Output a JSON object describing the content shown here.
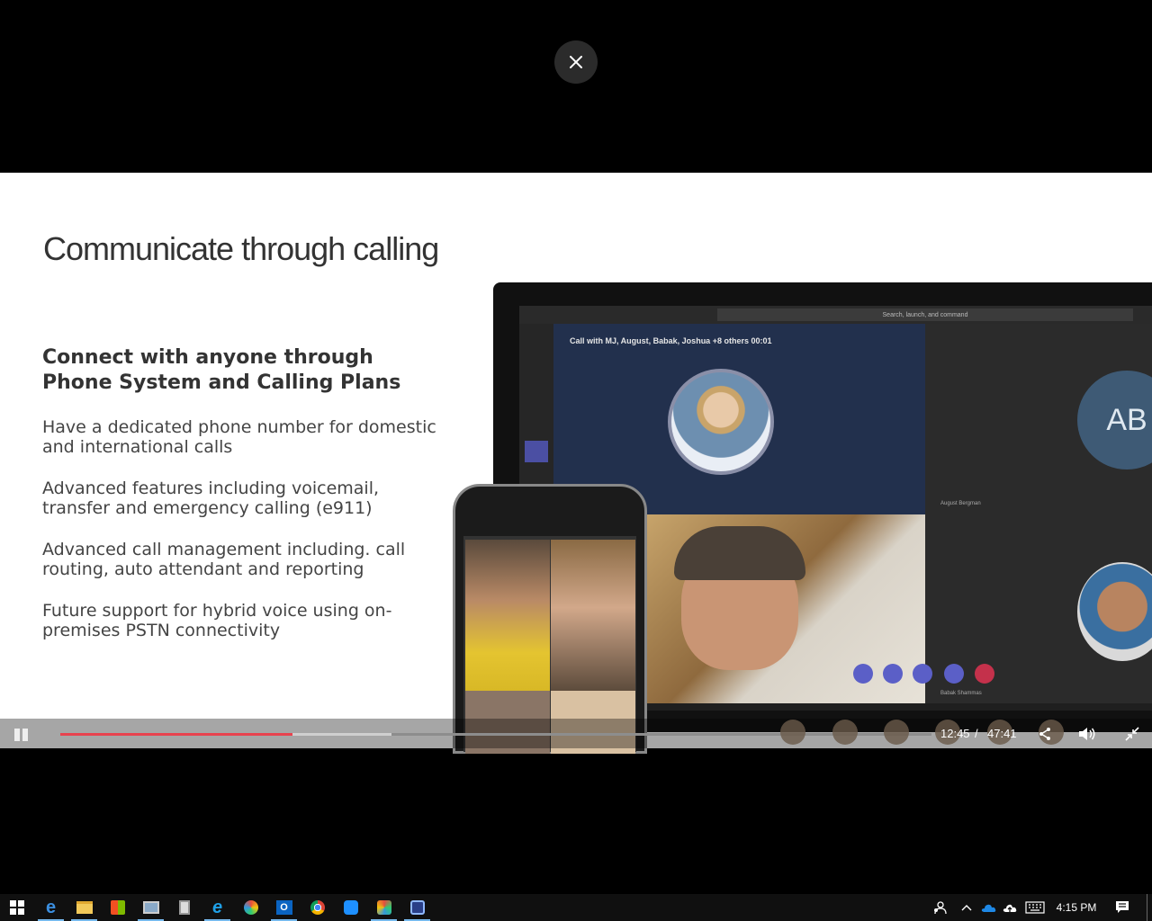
{
  "overlay": {
    "close_label": "✕"
  },
  "slide": {
    "title": "Communicate through calling",
    "subtitle": "Connect with anyone through Phone System and Calling Plans",
    "bullets": [
      "Have a dedicated phone number for domestic and international calls",
      "Advanced features including voicemail, transfer and emergency calling (e911)",
      "Advanced call management including. call routing, auto attendant and reporting",
      "Future support for hybrid voice using on-premises PSTN connectivity"
    ],
    "teams_search": "Search, launch, and command",
    "call_title": "Call with MJ, August, Babak, Joshua +8 others  00:01",
    "ab_initials": "AB",
    "name_august": "August Bergman",
    "name_babak": "Babak Shammas"
  },
  "player": {
    "current_time": "12:45",
    "separator": "/",
    "duration": "47:41",
    "played_fraction": 0.267,
    "buffered_fraction": 0.38,
    "accent_color": "#e8424e"
  },
  "taskbar": {
    "apps": [
      "start-icon",
      "edge-icon",
      "file-explorer-icon",
      "store-icon",
      "remote-desktop-icon",
      "calculator-icon",
      "internet-explorer-icon",
      "paint-icon",
      "outlook-icon",
      "chrome-icon",
      "messenger-icon",
      "app-icon",
      "screenshot-icon"
    ],
    "clock": "4:15 PM"
  }
}
